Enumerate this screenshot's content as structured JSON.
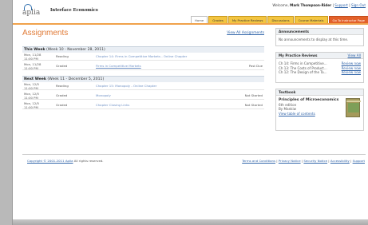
{
  "header": {
    "logo_text": "aplia",
    "course_title": "Interface Economics",
    "welcome_prefix": "Welcome,",
    "user_name": "Mark Thompson-Rider",
    "support_label": "Support",
    "signout_label": "Sign Out",
    "tabs": [
      {
        "label": "Home",
        "active": true
      },
      {
        "label": "Grades"
      },
      {
        "label": "My Practice Reviews"
      },
      {
        "label": "Discussions"
      },
      {
        "label": "Course Materials"
      },
      {
        "label": "Go To Instructor Page",
        "highlight": true
      }
    ]
  },
  "assignments": {
    "title": "Assignments",
    "view_all": "View All Assignments",
    "weeks": [
      {
        "label": "This Week",
        "range": "(Week 10 - November 28, 2011)",
        "rows": [
          {
            "date": "Mon, 11/28",
            "time": "11:00 PM",
            "type": "Reading",
            "name": "Chapter 14: Firms in Competitive Markets - Online Chapter",
            "status": ""
          },
          {
            "date": "Mon, 11/28",
            "time": "11:00 PM",
            "type": "Graded",
            "name": "Firms in Competitive Markets",
            "status": "Past Due"
          }
        ]
      },
      {
        "label": "Next Week",
        "range": "(Week 11 - December 5, 2011)",
        "rows": [
          {
            "date": "Mon, 12/5",
            "time": "11:00 PM",
            "type": "Reading",
            "name": "Chapter 15: Monopoly - Online Chapter",
            "status": ""
          },
          {
            "date": "Mon, 12/5",
            "time": "11:00 PM",
            "type": "Graded",
            "name": "Monopoly",
            "status": "Not Started"
          },
          {
            "date": "Mon, 12/5",
            "time": "11:00 PM",
            "type": "Graded",
            "name": "Chapter Closing Links",
            "status": "Not Started"
          }
        ]
      }
    ]
  },
  "sidebar": {
    "announcements": {
      "title": "Announcements",
      "body": "No announcements to display at this time."
    },
    "practice_reviews": {
      "title": "My Practice Reviews",
      "view_all": "View All",
      "items": [
        {
          "name": "Ch 14: Firms in Competitive...",
          "link": "Review now"
        },
        {
          "name": "Ch 13: The Costs of Product...",
          "link": "Review now"
        },
        {
          "name": "Ch 12: The Design of the Ta...",
          "link": "Review now"
        }
      ]
    },
    "textbook": {
      "title": "Textbook",
      "book_title": "Principles of Microeconomics",
      "edition": "6th edition",
      "author": "By Mankiw",
      "toc": "View table of contents"
    }
  },
  "footer": {
    "copyright": "Copyright © 2001-2011 Aplia",
    "rights": "All rights reserved.",
    "links": [
      "Terms and Conditions",
      "Privacy Notice",
      "Security Notice",
      "Accessibility",
      "Support"
    ]
  }
}
